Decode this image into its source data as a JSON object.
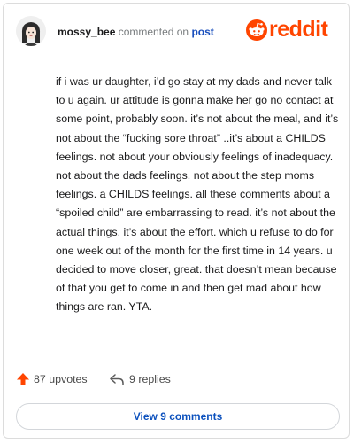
{
  "comment": {
    "username": "mossy_bee",
    "action_text": "commented on",
    "post_link": "post",
    "body": "if i was ur daughter, i’d go stay at my dads and never talk to u again. ur attitude is gonna make her go no contact at some point, probably soon. it’s not about the meal, and it’s not about the “fucking sore throat” ..it’s about a CHILDS feelings. not about your obviously feelings of inadequacy. not about the dads feelings. not about the step moms feelings. a CHILDS feelings. all these comments about a “spoiled child” are embarrassing to read. it’s not about the actual things, it’s about the effort. which u refuse to do for one week out of the month for the first time in 14 years. u decided to move closer, great. that doesn’t mean because of that you get to come in and then get mad about how things are ran. YTA.",
    "upvotes_label": "87 upvotes",
    "replies_label": "9 replies",
    "view_button_label": "View 9 comments"
  },
  "brand": {
    "name": "reddit",
    "color": "#ff4500"
  },
  "icons": {
    "upvote": "upvote-arrow-icon",
    "reply": "reply-arrow-icon",
    "logo": "reddit-alien-icon",
    "avatar": "avatar-girl-icon"
  },
  "colors": {
    "link": "#1a4fbd",
    "button_text": "#0b50bd",
    "upvote": "#ff4500"
  }
}
